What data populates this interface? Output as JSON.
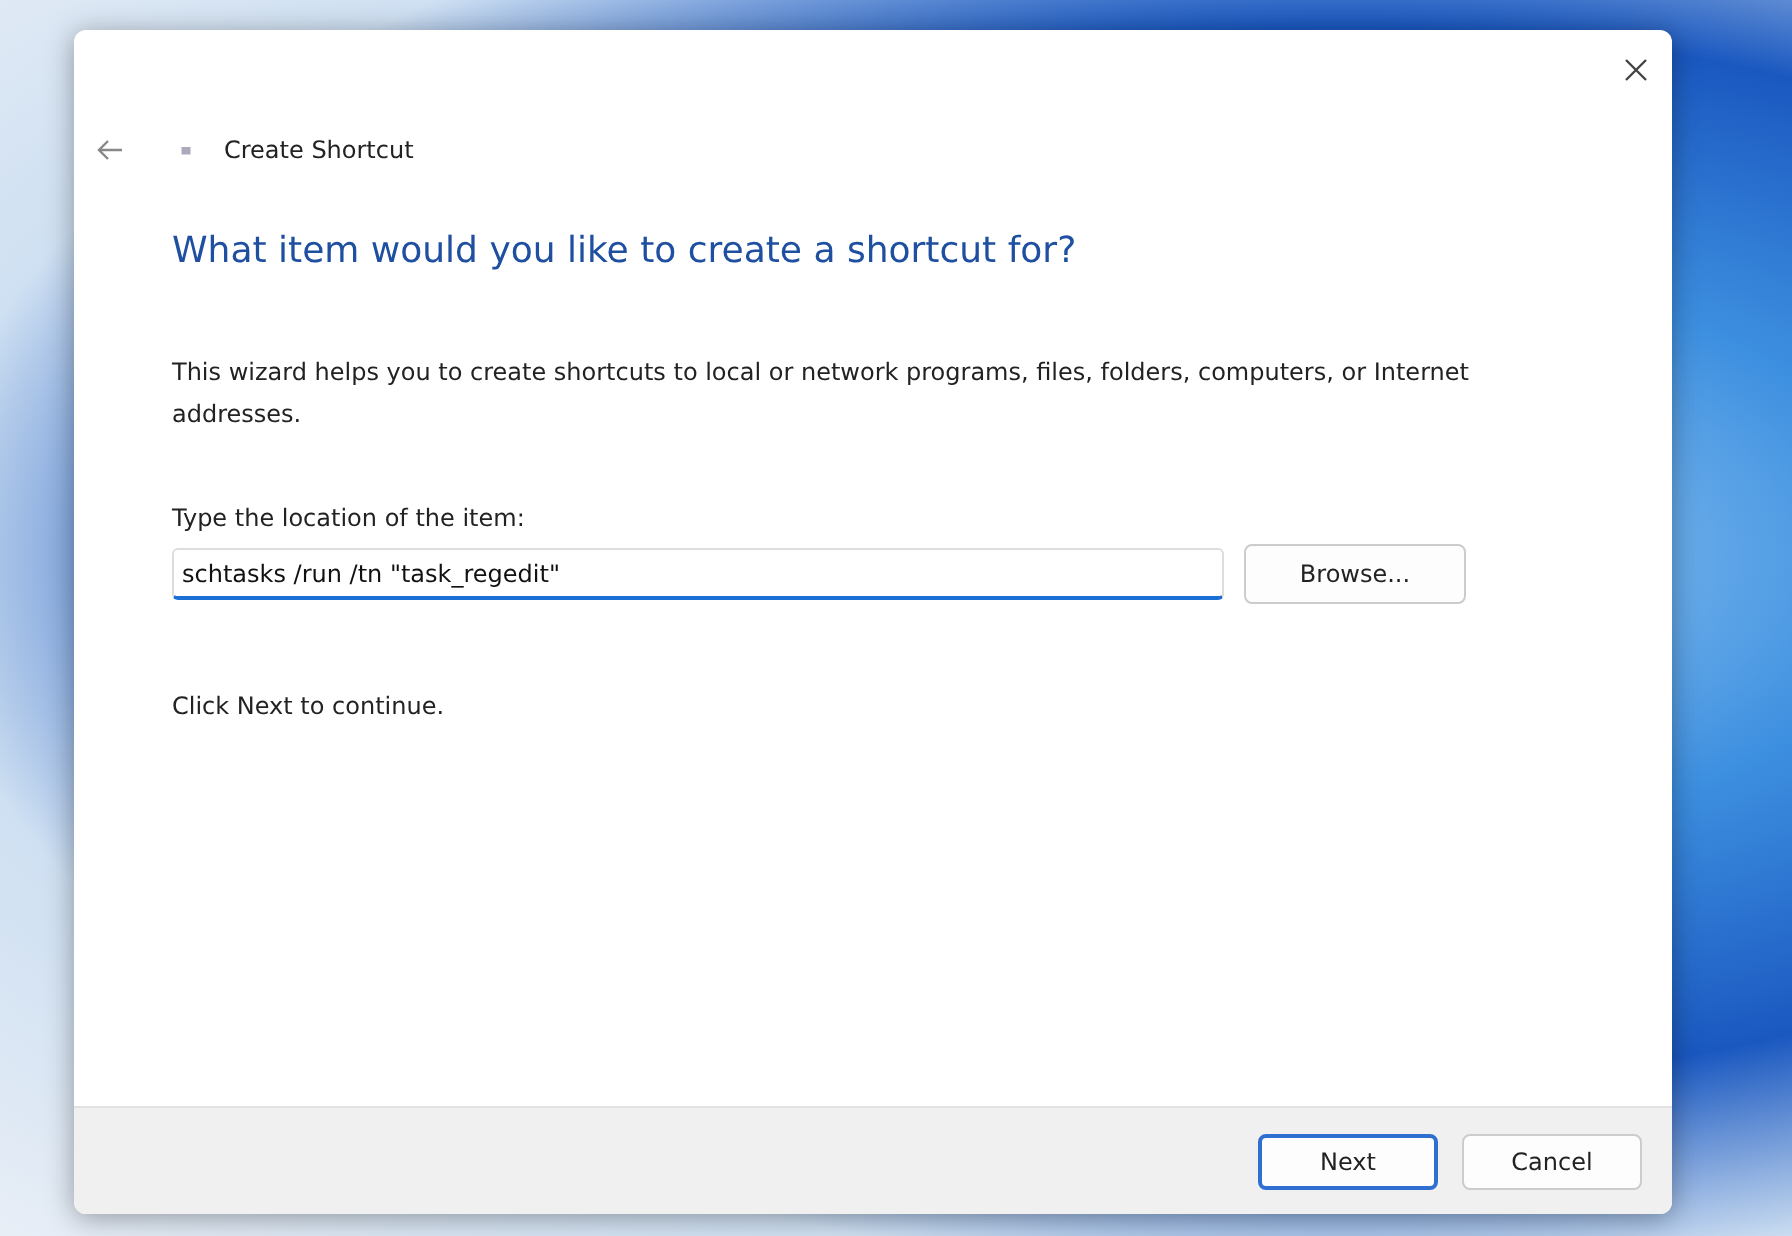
{
  "window": {
    "title": "Create Shortcut"
  },
  "heading": "What item would you like to create a shortcut for?",
  "description": "This wizard helps you to create shortcuts to local or network programs, files, folders, computers, or Internet addresses.",
  "location": {
    "label": "Type the location of the item:",
    "value": "schtasks /run /tn \"task_regedit\"",
    "browse_button": "Browse..."
  },
  "instruction": "Click Next to continue.",
  "buttons": [
    {
      "label": "Next",
      "default": true
    },
    {
      "label": "Cancel",
      "default": false
    }
  ]
}
